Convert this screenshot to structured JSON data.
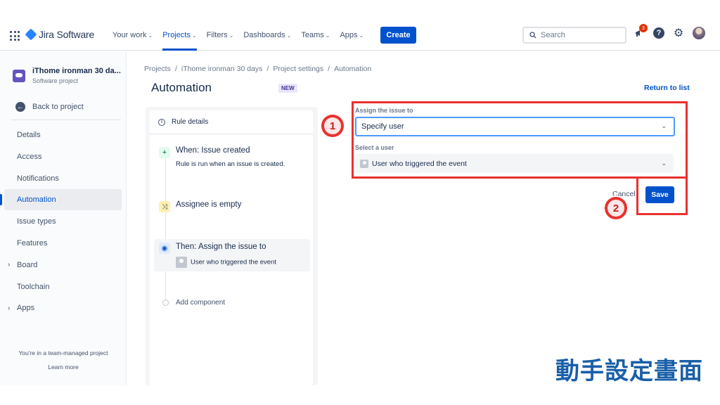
{
  "nav": {
    "logo": "Jira Software",
    "items": [
      {
        "label": "Your work",
        "chevron": true,
        "active": false
      },
      {
        "label": "Projects",
        "chevron": true,
        "active": true
      },
      {
        "label": "Filters",
        "chevron": true,
        "active": false
      },
      {
        "label": "Dashboards",
        "chevron": true,
        "active": false
      },
      {
        "label": "Teams",
        "chevron": true,
        "active": false
      },
      {
        "label": "Apps",
        "chevron": true,
        "active": false
      }
    ],
    "create_label": "Create",
    "search_placeholder": "Search",
    "notifications_count": "3",
    "help_label": "?"
  },
  "sidebar": {
    "project_name": "iThome ironman 30 da...",
    "project_type": "Software project",
    "back_label": "Back to project",
    "items": [
      {
        "label": "Details",
        "active": false,
        "expandable": false
      },
      {
        "label": "Access",
        "active": false,
        "expandable": false
      },
      {
        "label": "Notifications",
        "active": false,
        "expandable": false
      },
      {
        "label": "Automation",
        "active": true,
        "expandable": false
      },
      {
        "label": "Issue types",
        "active": false,
        "expandable": false
      },
      {
        "label": "Features",
        "active": false,
        "expandable": false
      },
      {
        "label": "Board",
        "active": false,
        "expandable": true
      },
      {
        "label": "Toolchain",
        "active": false,
        "expandable": false
      },
      {
        "label": "Apps",
        "active": false,
        "expandable": true
      }
    ],
    "team_note": "You're in a team-managed project",
    "learn_more": "Learn more"
  },
  "breadcrumb": [
    "Projects",
    "iThome ironman 30 days",
    "Project settings",
    "Automation"
  ],
  "page": {
    "title": "Automation",
    "badge": "NEW",
    "return_link": "Return to list"
  },
  "rule": {
    "details_label": "Rule details",
    "trigger_title": "When: Issue created",
    "trigger_sub": "Rule is run when an issue is created.",
    "condition_title": "Assignee is empty",
    "action_title": "Then: Assign the issue to",
    "action_sub": "User who triggered the event",
    "add_component": "Add component"
  },
  "form": {
    "assign_label": "Assign the issue to",
    "assign_value": "Specify user",
    "user_label": "Select a user",
    "user_value": "User who triggered the event",
    "cancel_label": "Cancel",
    "save_label": "Save"
  },
  "annotations": {
    "marker1": "1",
    "marker2": "2",
    "caption": "動手設定畫面"
  },
  "colors": {
    "brand": "#0052cc",
    "highlight": "#e8312f",
    "caption": "#1a5fa8"
  }
}
